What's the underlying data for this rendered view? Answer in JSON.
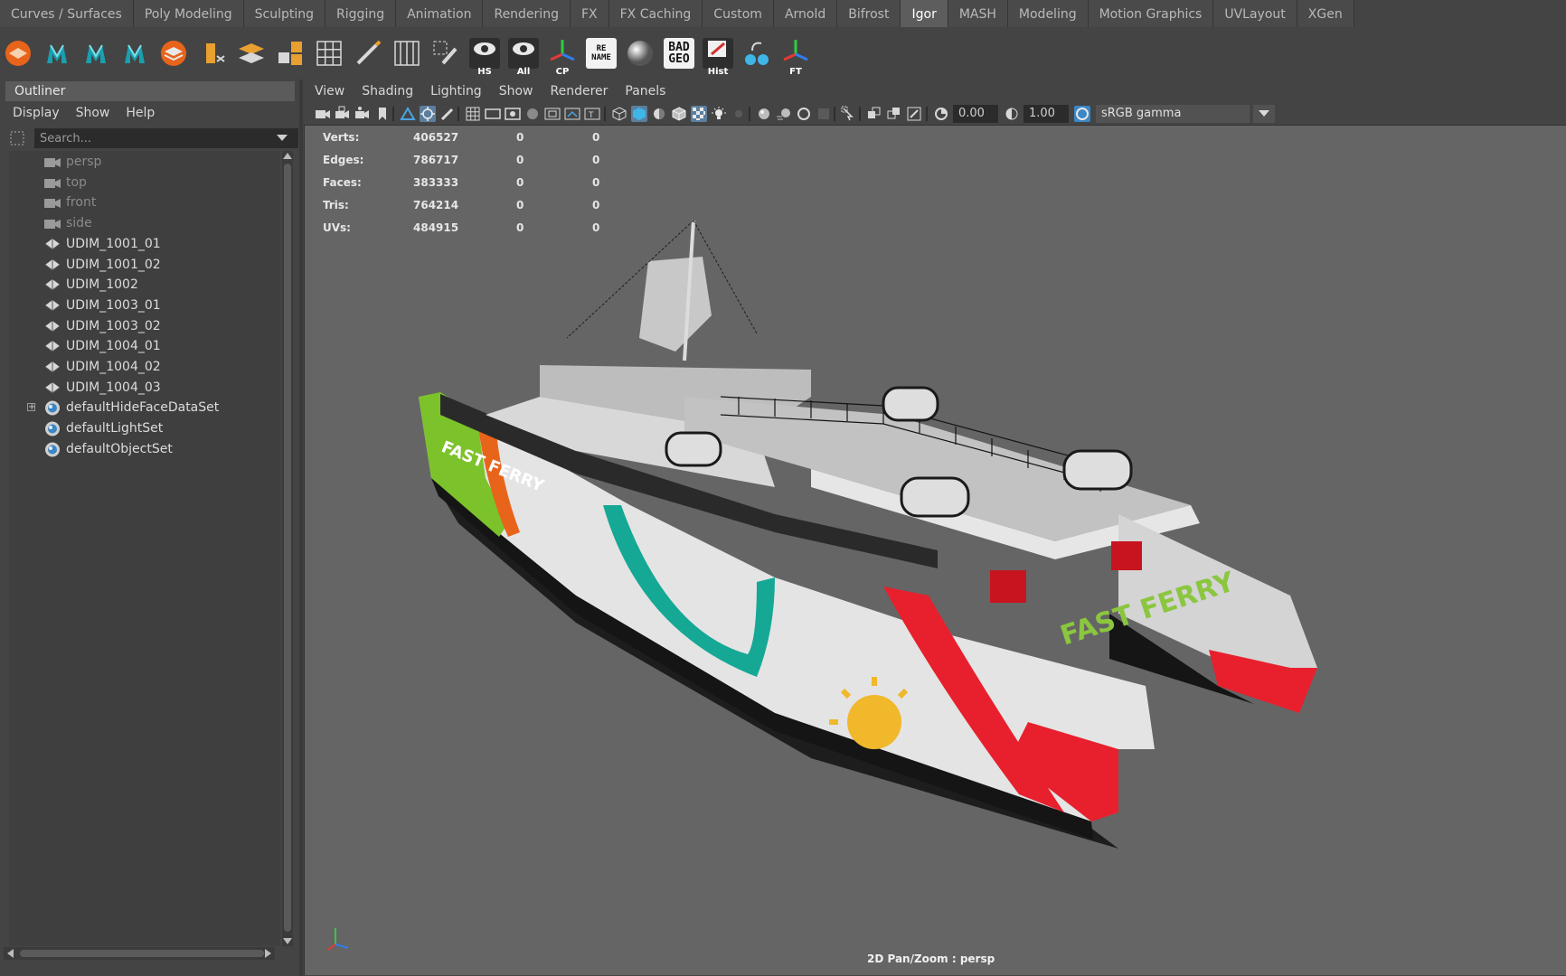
{
  "shelf": {
    "tabs": [
      "Curves / Surfaces",
      "Poly Modeling",
      "Sculpting",
      "Rigging",
      "Animation",
      "Rendering",
      "FX",
      "FX Caching",
      "Custom",
      "Arnold",
      "Bifrost",
      "Igor",
      "MASH",
      "Modeling",
      "Motion Graphics",
      "UVLayout",
      "XGen"
    ],
    "active_tab": "Igor",
    "buttons": [
      {
        "icon": "orange-layers-icon",
        "label": ""
      },
      {
        "icon": "teal-figure-icon",
        "label": ""
      },
      {
        "icon": "teal-figure-icon",
        "label": ""
      },
      {
        "icon": "teal-figure-icon",
        "label": ""
      },
      {
        "icon": "layer-stack-icon",
        "label": ""
      },
      {
        "icon": "box-arrows-icon",
        "label": ""
      },
      {
        "icon": "planes-icon",
        "label": ""
      },
      {
        "icon": "quad-blocks-icon",
        "label": ""
      },
      {
        "icon": "grid-icon",
        "label": ""
      },
      {
        "icon": "pencil-ruler-icon",
        "label": ""
      },
      {
        "icon": "mirror-grid-icon",
        "label": ""
      },
      {
        "icon": "select-pencil-icon",
        "label": ""
      },
      {
        "icon": "eye-icon",
        "label": "HS"
      },
      {
        "icon": "eye-icon",
        "label": "All"
      },
      {
        "icon": "axis-icon",
        "label": "CP"
      },
      {
        "icon": "rename-icon",
        "label": "RE NAME"
      },
      {
        "icon": "sphere-icon",
        "label": ""
      },
      {
        "icon": "bad-geo-icon",
        "label": "BAD GEO"
      },
      {
        "icon": "history-pencil-icon",
        "label": "Hist"
      },
      {
        "icon": "node-link-icon",
        "label": ""
      },
      {
        "icon": "axis-icon",
        "label": "FT"
      }
    ]
  },
  "outliner": {
    "title": "Outliner",
    "menu": [
      "Display",
      "Show",
      "Help"
    ],
    "search_placeholder": "Search...",
    "items": [
      {
        "label": "persp",
        "icon": "camera-icon",
        "dim": true
      },
      {
        "label": "top",
        "icon": "camera-icon",
        "dim": true
      },
      {
        "label": "front",
        "icon": "camera-icon",
        "dim": true
      },
      {
        "label": "side",
        "icon": "camera-icon",
        "dim": true
      },
      {
        "label": "UDIM_1001_01",
        "icon": "mesh-icon",
        "dim": false
      },
      {
        "label": "UDIM_1001_02",
        "icon": "mesh-icon",
        "dim": false
      },
      {
        "label": "UDIM_1002",
        "icon": "mesh-icon",
        "dim": false
      },
      {
        "label": "UDIM_1003_01",
        "icon": "mesh-icon",
        "dim": false
      },
      {
        "label": "UDIM_1003_02",
        "icon": "mesh-icon",
        "dim": false
      },
      {
        "label": "UDIM_1004_01",
        "icon": "mesh-icon",
        "dim": false
      },
      {
        "label": "UDIM_1004_02",
        "icon": "mesh-icon",
        "dim": false
      },
      {
        "label": "UDIM_1004_03",
        "icon": "mesh-icon",
        "dim": false
      },
      {
        "label": "defaultHideFaceDataSet",
        "icon": "set-icon",
        "dim": false,
        "expandable": true
      },
      {
        "label": "defaultLightSet",
        "icon": "set-icon",
        "dim": false
      },
      {
        "label": "defaultObjectSet",
        "icon": "set-icon",
        "dim": false
      }
    ]
  },
  "viewport": {
    "menu": [
      "View",
      "Shading",
      "Lighting",
      "Show",
      "Renderer",
      "Panels"
    ],
    "exposure": "0.00",
    "gamma": "1.00",
    "color_space": "sRGB gamma",
    "camera_readout": "2D Pan/Zoom : persp",
    "hud": [
      {
        "label": "Verts:",
        "v1": "406527",
        "v2": "0",
        "v3": "0"
      },
      {
        "label": "Edges:",
        "v1": "786717",
        "v2": "0",
        "v3": "0"
      },
      {
        "label": "Faces:",
        "v1": "383333",
        "v2": "0",
        "v3": "0"
      },
      {
        "label": "Tris:",
        "v1": "764214",
        "v2": "0",
        "v3": "0"
      },
      {
        "label": "UVs:",
        "v1": "484915",
        "v2": "0",
        "v3": "0"
      }
    ],
    "hull_text": "FAST FERRY"
  },
  "colors": {
    "ui_bg": "#444444",
    "viewport_bg": "#656565",
    "accent_teal": "#15a895",
    "accent_red": "#e8202e",
    "accent_orange": "#e8641a",
    "accent_green": "#7cc22a"
  }
}
